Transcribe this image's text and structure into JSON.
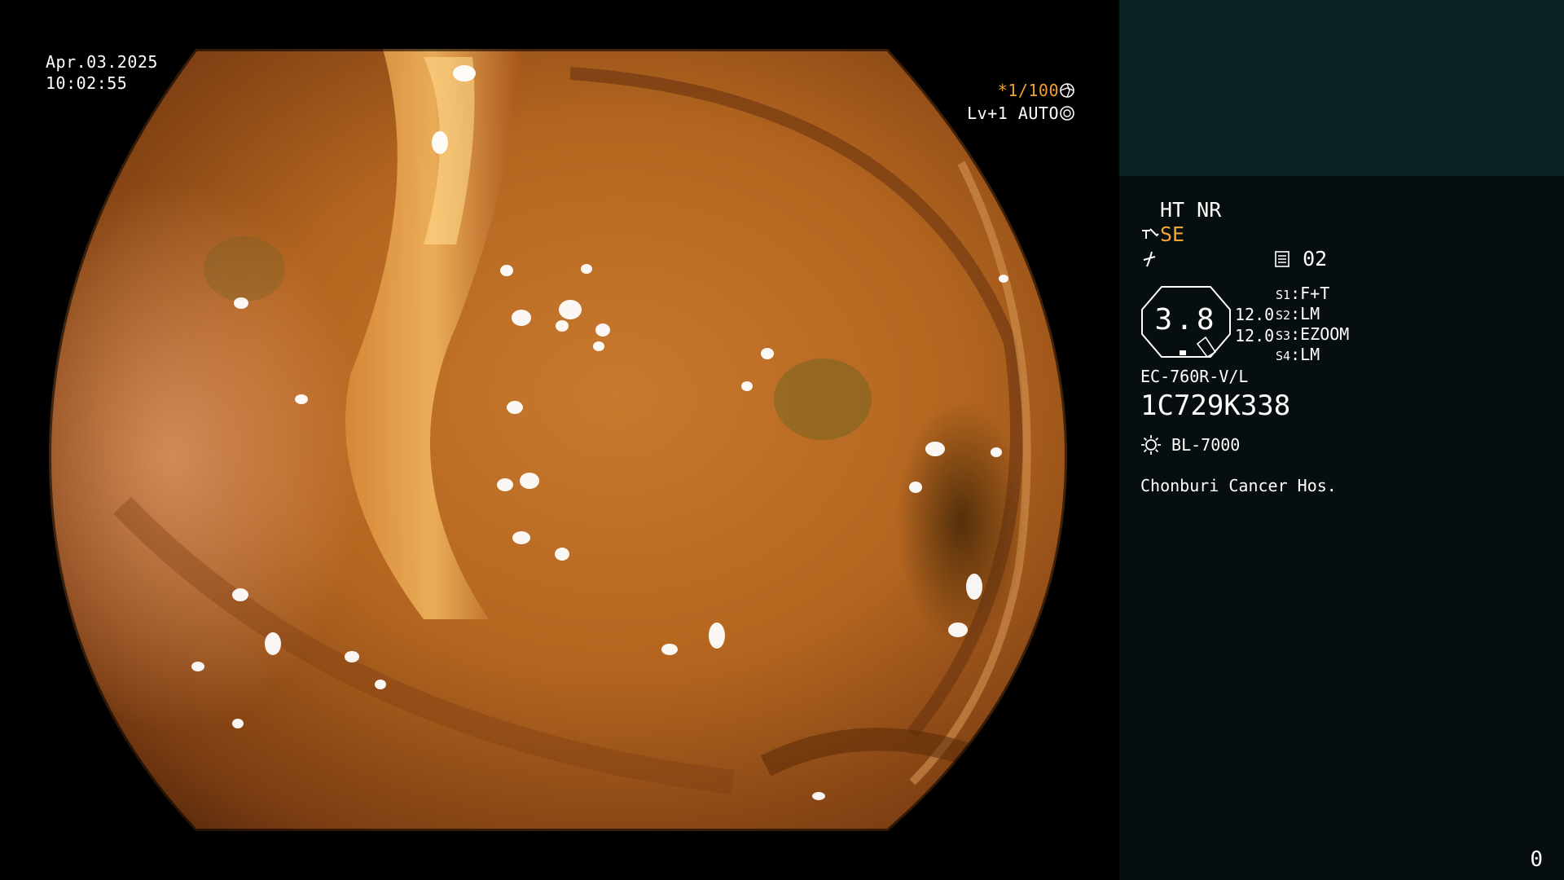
{
  "overlay": {
    "date": "Apr.03.2025",
    "time": "10:02:55",
    "shutter": "*1/100",
    "shutter_icon": "aperture-icon",
    "level": "Lv+1 AUTO",
    "level_icon": "exposure-icon"
  },
  "panel": {
    "ht_nr": "HT NR",
    "se_label": "SE",
    "se_icon": "enhance-icon",
    "f_icon": "freeze-icon",
    "mem_icon": "memory-icon",
    "mem_value": "02",
    "iris_value": "3.8",
    "values": [
      "12.0",
      "12.0"
    ],
    "switches": [
      {
        "key": "S1",
        "value": "F+T"
      },
      {
        "key": "S2",
        "value": "LM"
      },
      {
        "key": "S3",
        "value": "EZOOM"
      },
      {
        "key": "S4",
        "value": "LM"
      }
    ],
    "scope_model": "EC-760R-V/L",
    "serial": "1C729K338",
    "light_icon": "sun-icon",
    "light_source": "BL-7000",
    "hospital": "Chonburi Cancer Hos.",
    "counter": "0"
  },
  "colors": {
    "accent_amber": "#f0a030",
    "panel_bg": "#070e0f",
    "panel_top_bg": "#0b2225"
  }
}
